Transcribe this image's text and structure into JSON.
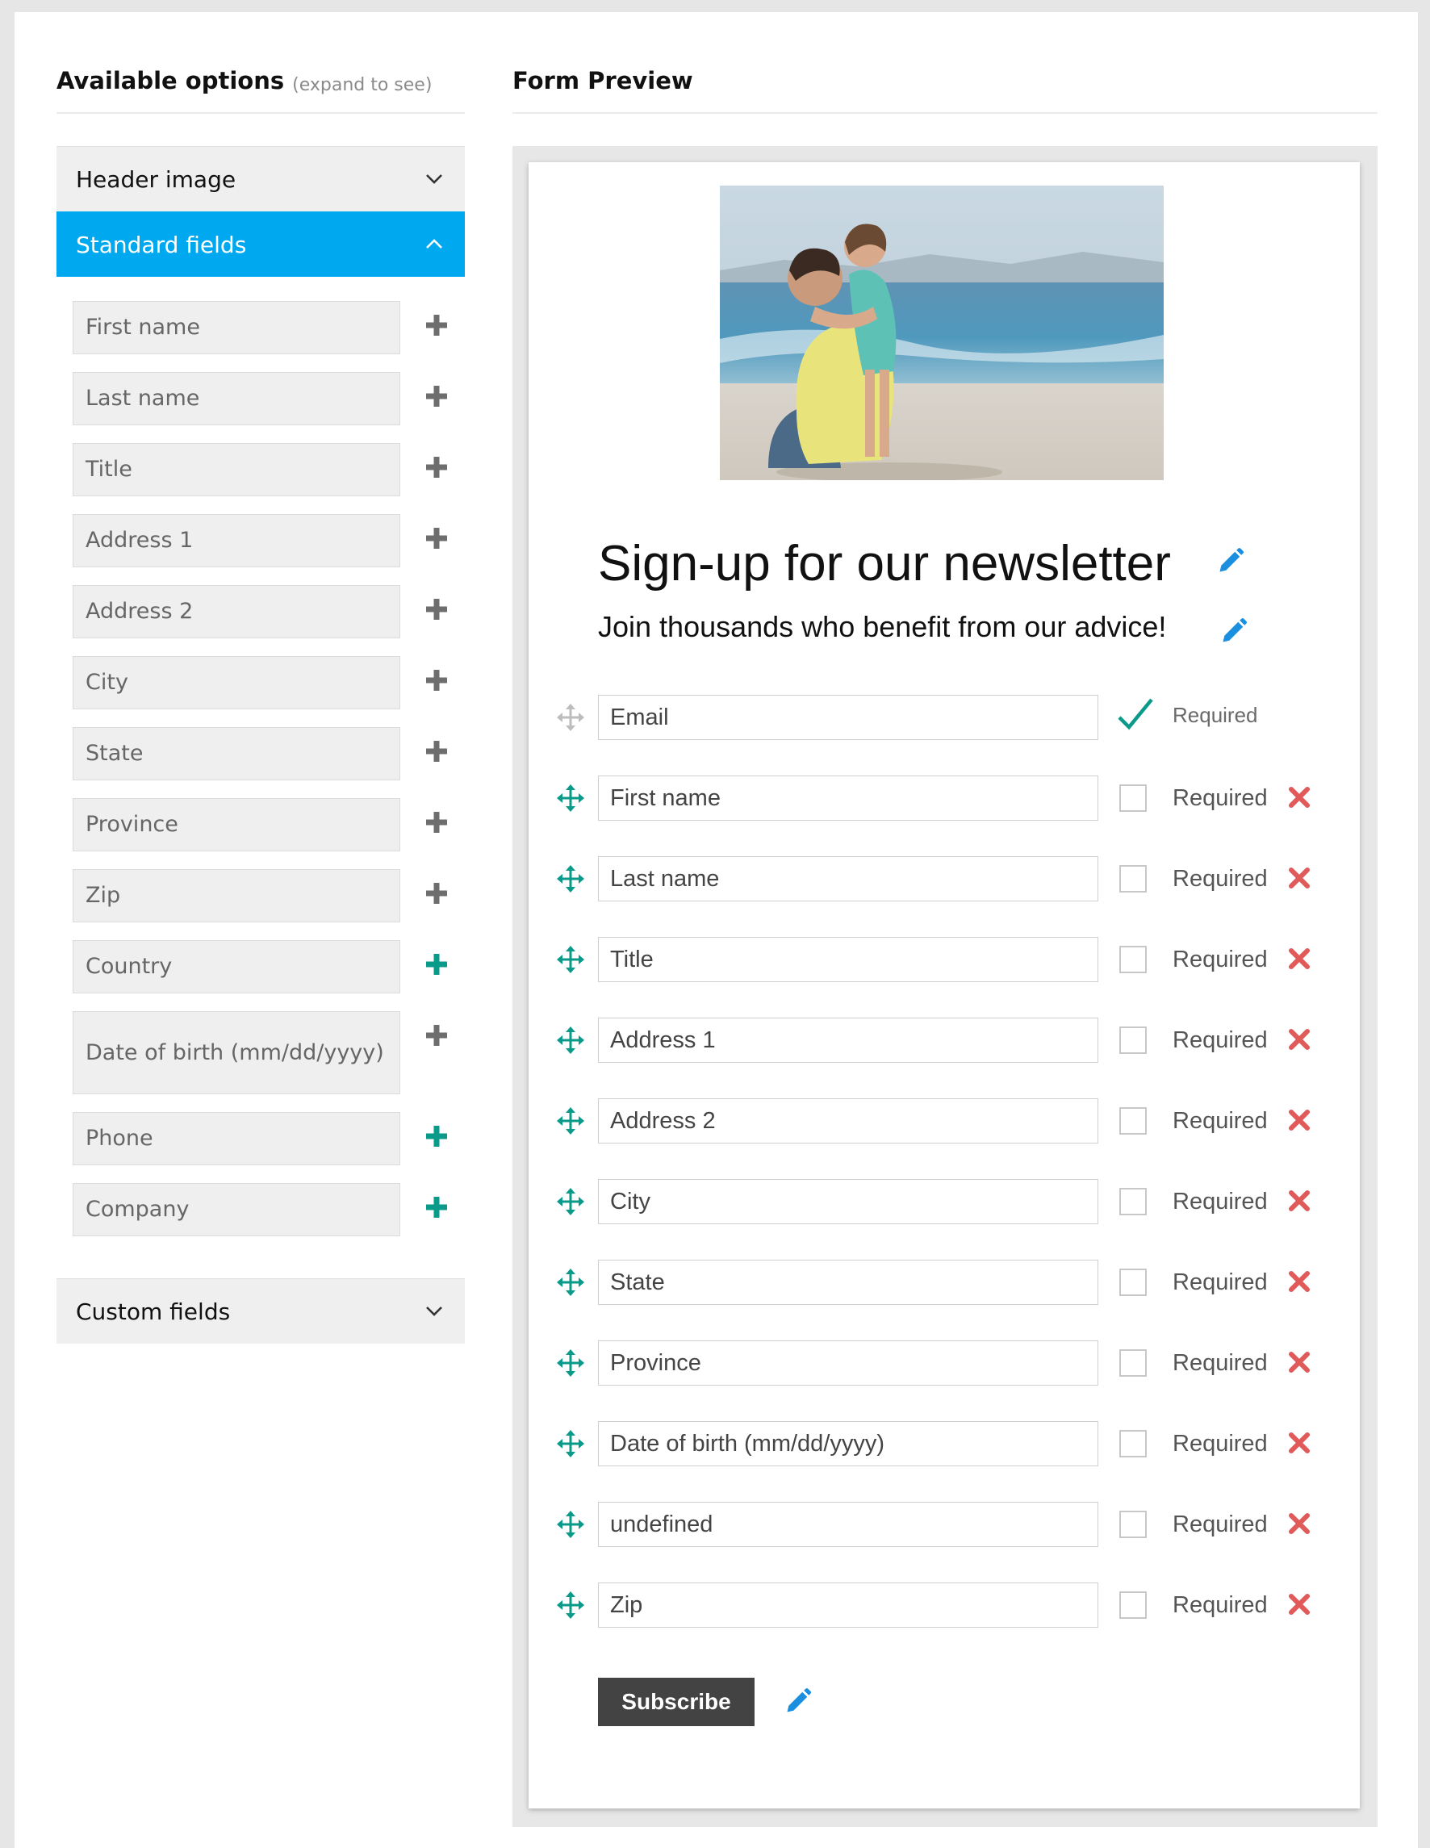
{
  "left": {
    "title": "Available options",
    "hint": "(expand to see)",
    "sections": {
      "header_image": "Header image",
      "standard_fields": "Standard fields",
      "custom_fields": "Custom fields"
    },
    "fields": [
      {
        "label": "First name",
        "added": true
      },
      {
        "label": "Last name",
        "added": true
      },
      {
        "label": "Title",
        "added": true
      },
      {
        "label": "Address 1",
        "added": true
      },
      {
        "label": "Address 2",
        "added": true
      },
      {
        "label": "City",
        "added": true
      },
      {
        "label": "State",
        "added": true
      },
      {
        "label": "Province",
        "added": true
      },
      {
        "label": "Zip",
        "added": true
      },
      {
        "label": "Country",
        "added": false
      },
      {
        "label": "Date of birth (mm/dd/yyyy)",
        "added": true
      },
      {
        "label": "Phone",
        "added": false
      },
      {
        "label": "Company",
        "added": false
      }
    ]
  },
  "right": {
    "title": "Form Preview",
    "form_title": "Sign-up for our newsletter",
    "form_subtitle": "Join thousands who benefit from our advice!",
    "required_label": "Required",
    "rows": [
      {
        "value": "Email",
        "locked": true,
        "required": true
      },
      {
        "value": "First name",
        "locked": false,
        "required": false
      },
      {
        "value": "Last name",
        "locked": false,
        "required": false
      },
      {
        "value": "Title",
        "locked": false,
        "required": false
      },
      {
        "value": "Address 1",
        "locked": false,
        "required": false
      },
      {
        "value": "Address 2",
        "locked": false,
        "required": false
      },
      {
        "value": "City",
        "locked": false,
        "required": false
      },
      {
        "value": "State",
        "locked": false,
        "required": false
      },
      {
        "value": "Province",
        "locked": false,
        "required": false
      },
      {
        "value": "Date of birth (mm/dd/yyyy)",
        "locked": false,
        "required": false
      },
      {
        "value": "undefined",
        "locked": false,
        "required": false
      },
      {
        "value": "Zip",
        "locked": false,
        "required": false
      }
    ],
    "subscribe_label": "Subscribe"
  },
  "colors": {
    "accent_blue": "#00a9ef",
    "teal": "#0a9a8a",
    "delete_red": "#e05a5a",
    "button_dark": "#434343"
  },
  "icons": {
    "chevron_down": "chevron-down-icon",
    "chevron_up": "chevron-up-icon",
    "plus": "plus-icon",
    "move": "move-icon",
    "pencil": "pencil-icon",
    "check": "check-icon",
    "delete": "delete-icon"
  }
}
